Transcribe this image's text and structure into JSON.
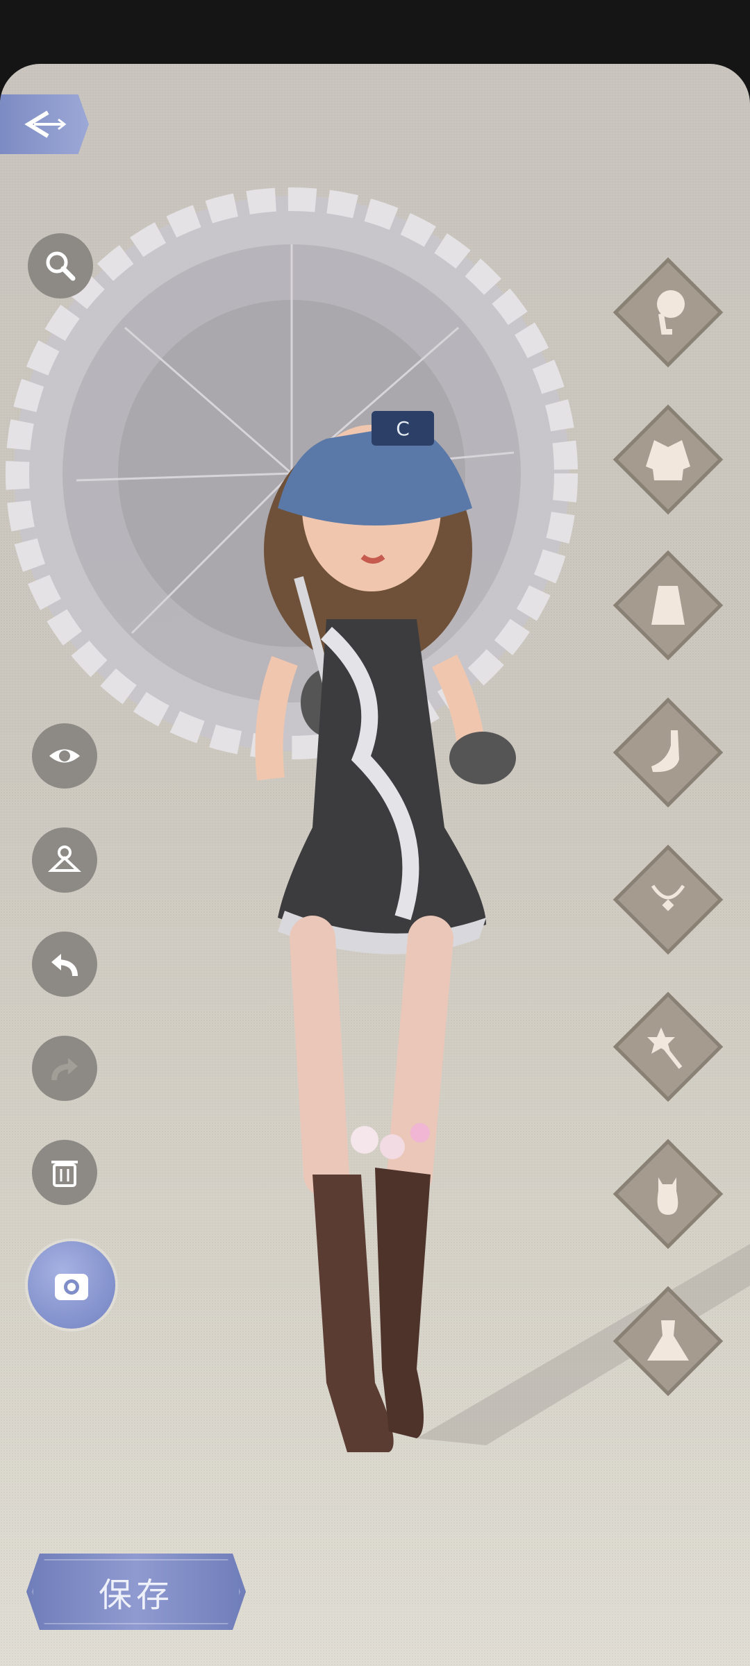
{
  "save_label": "保存",
  "left_toolbar": [
    "search-icon",
    "eye-icon",
    "hanger-icon",
    "undo-icon",
    "redo-icon",
    "trash-icon",
    "camera-icon"
  ],
  "categories": [
    "hairstyle",
    "jacket",
    "top",
    "shoes",
    "necklace",
    "wand",
    "pet",
    "dress"
  ],
  "colors": {
    "accent": "#7c8bc3",
    "button_gray": "#8d8984",
    "category": "#a59c8f"
  }
}
